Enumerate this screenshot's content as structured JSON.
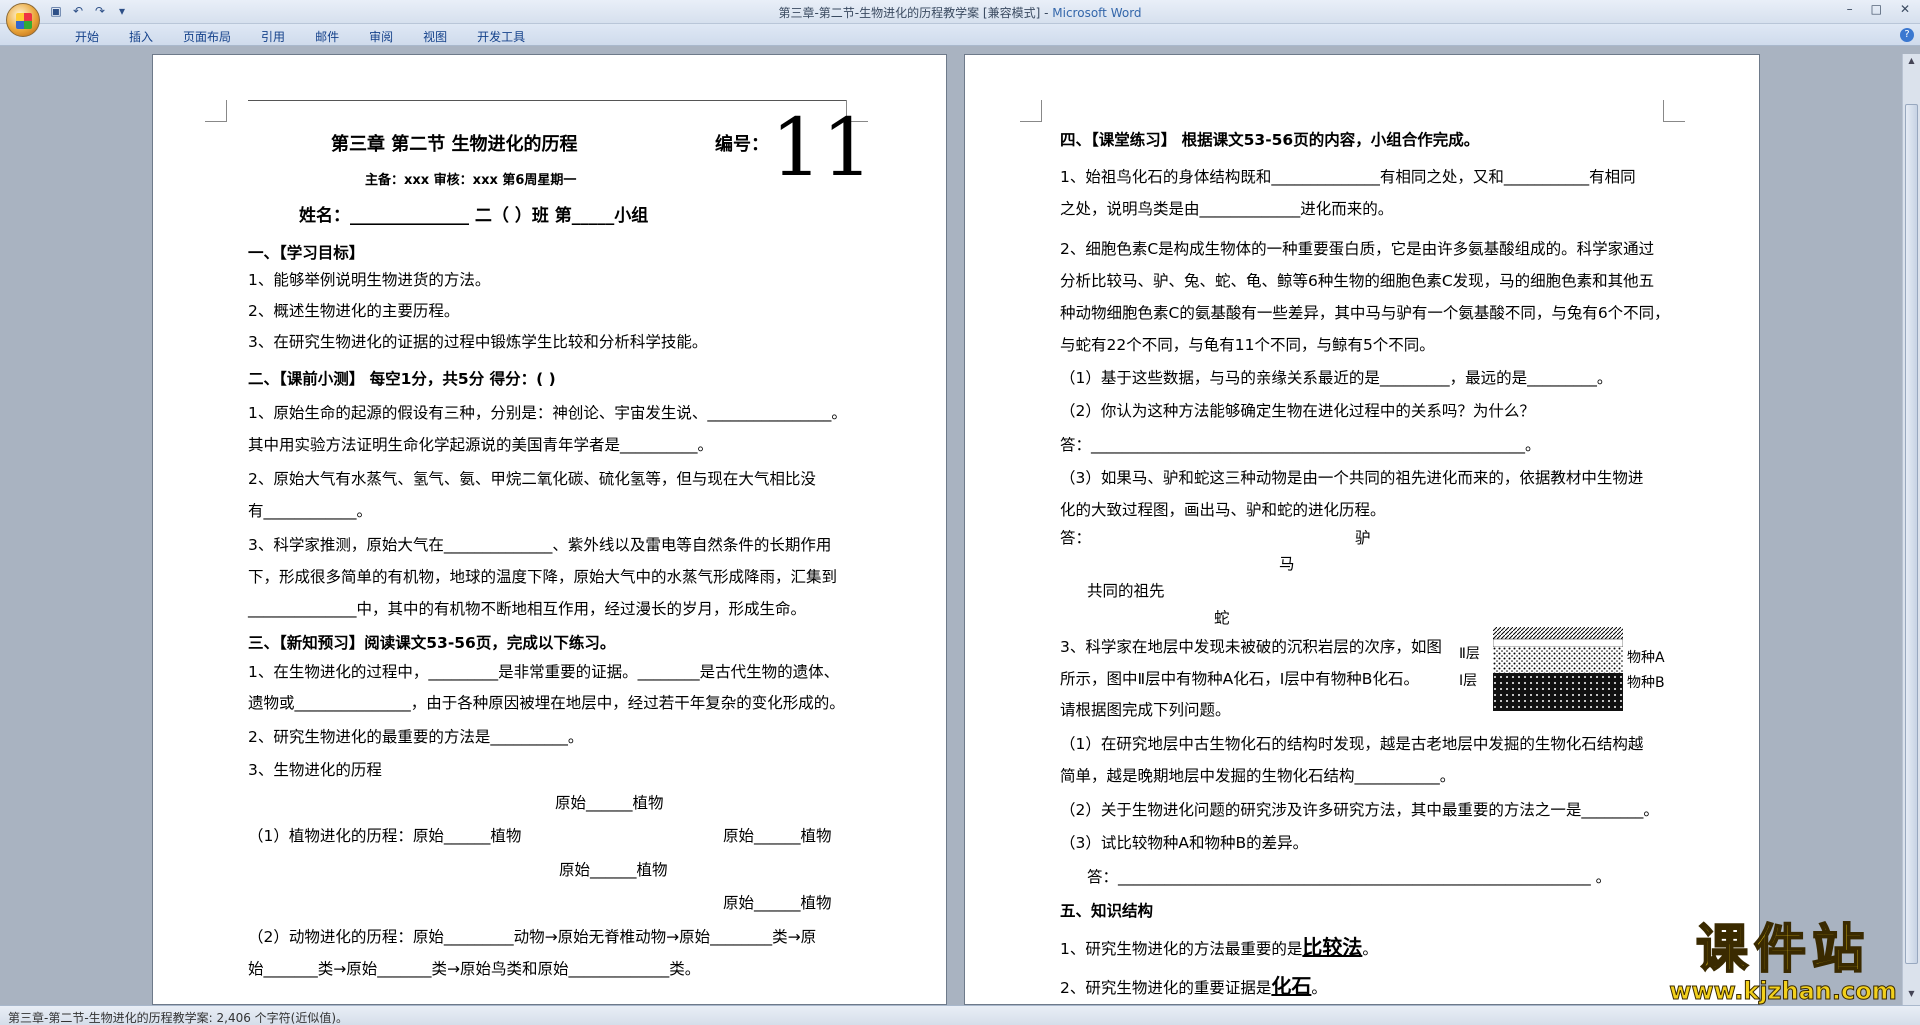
{
  "window": {
    "title": "第三章-第二节-生物进化的历程教学案 [兼容模式]",
    "app_name": "Microsoft Word",
    "controls": [
      "–",
      "□",
      "✕"
    ]
  },
  "ribbon": {
    "tabs": [
      "开始",
      "插入",
      "页面布局",
      "引用",
      "邮件",
      "审阅",
      "视图",
      "开发工具"
    ]
  },
  "icons": [
    "office-button-icon",
    "save-icon",
    "undo-icon",
    "redo-icon",
    "help-icon"
  ],
  "status": {
    "text": "第三章-第二节-生物进化的历程教学案: 2,406 个字符(近似值)。"
  },
  "watermark": {
    "logo": "课件站",
    "url": "www.kjzhan.com"
  },
  "page1": {
    "title": "第三章  第二节  生物进化的历程",
    "number_label": "编号：",
    "number": "11",
    "editors": "主备：xxx  审核：xxx   第6周星期一",
    "name_line": "姓名：______________    二（       ）班      第_____小组",
    "s1_title": "一、【学习目标】",
    "s1_l1": "1、能够举例说明生物进货的方法。",
    "s1_l2": "2、概述生物进化的主要历程。",
    "s1_l3": "3、在研究生物进化的证据的过程中锻炼学生比较和分析科学技能。",
    "s2_title": "二、【课前小测】 每空1分，共5分            得分：(           )",
    "s2_l1": "1、原始生命的起源的假设有三种，分别是：神创论、宇宙发生说、________________。",
    "s2_l2": "其中用实验方法证明生命化学起源说的美国青年学者是__________。",
    "s2_l3": "2、原始大气有水蒸气、氢气、氨、甲烷二氧化碳、硫化氢等，但与现在大气相比没",
    "s2_l4": "有____________。",
    "s2_l5": "3、科学家推测，原始大气在______________、紫外线以及雷电等自然条件的长期作用",
    "s2_l6": "下，形成很多简单的有机物，地球的温度下降，原始大气中的水蒸气形成降雨，汇集到",
    "s2_l7": "______________中，其中的有机物不断地相互作用，经过漫长的岁月，形成生命。",
    "s3_title": "三、【新知预习】阅读课文53-56页，完成以下练习。",
    "s3_l1": "1、在生物进化的过程中，_________是非常重要的证据。________是古代生物的遗体、",
    "s3_l2": "遗物或_______________，由于各种原因被埋在地层中，经过若干年复杂的变化形成的。",
    "s3_l3": "2、研究生物进化的最重要的方法是__________。",
    "s3_l4": "3、生物进化的历程",
    "tree_a": "原始______植物",
    "tree_b_left": "（1）植物进化的历程：原始______植物",
    "tree_b_right": "原始______植物",
    "tree_c": "原始______植物",
    "tree_d": "原始______植物",
    "s3_l5": "（2）动物进化的历程：原始_________动物→原始无脊椎动物→原始________类→原",
    "s3_l6": "始_______类→原始_______类→原始鸟类和原始_____________类。"
  },
  "page2": {
    "s4_title": "四、【课堂练习】 根据课文53-56页的内容，小组合作完成。",
    "l1": "1、始祖鸟化石的身体结构既和______________有相同之处，又和___________有相同",
    "l2": "之处，说明鸟类是由_____________进化而来的。",
    "l3": "2、细胞色素C是构成生物体的一种重要蛋白质，它是由许多氨基酸组成的。科学家通过",
    "l4": "分析比较马、驴、兔、蛇、龟、鲸等6种生物的细胞色素C发现，马的细胞色素和其他五",
    "l5": "种动物细胞色素C的氨基酸有一些差异，其中马与驴有一个氨基酸不同，与兔有6个不同，",
    "l6": "与蛇有22个不同，与龟有11个不同，与鲸有5个不同。",
    "l7": "（1）基于这些数据，与马的亲缘关系最近的是_________，最远的是_________。",
    "l8": "（2）你认为这种方法能够确定生物在进化过程中的关系吗？为什么？",
    "l9": "答：________________________________________________________。",
    "l10": "（3）如果马、驴和蛇这三种动物是由一个共同的祖先进化而来的，依据教材中生物进",
    "l11": "化的大致过程图，画出马、驴和蛇的进化历程。",
    "ans": "答：",
    "donkey": "驴",
    "horse": "马",
    "ancestor": "共同的祖先",
    "snake": "蛇",
    "l12": "3、科学家在地层中发现未被破的沉积岩层的次序，如图",
    "l13": "所示，图中Ⅱ层中有物种A化石，Ⅰ层中有物种B化石。",
    "l14": "请根据图完成下列问题。",
    "layer2": "Ⅱ层",
    "layer1": "Ⅰ层",
    "speciesA": "物种A",
    "speciesB": "物种B",
    "l15": "（1）在研究地层中古生物化石的结构时发现，越是古老地层中发掘的生物化石结构越",
    "l16": "简单，越是晚期地层中发掘的生物化石结构___________。",
    "l17": "（2）关于生物进化问题的研究涉及许多研究方法，其中最重要的方法之一是________。",
    "l18": "（3）试比较物种A和物种B的差异。",
    "l19": "答：_____________________________________________________________ 。",
    "s5_title": "五、知识结构",
    "k1_pre": "1、研究生物进化的方法最重要的是",
    "k1_key": "比较法",
    "k1_post": "。",
    "k2_pre": "2、研究生物进化的重要证据是",
    "k2_key": "化石",
    "k2_post": "。"
  }
}
